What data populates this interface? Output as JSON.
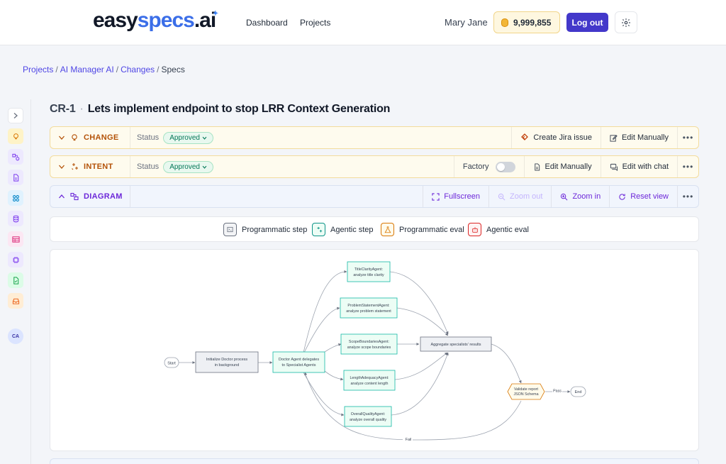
{
  "header": {
    "logo": {
      "part1": "easy",
      "part2": "specs",
      "part3": ".ai"
    },
    "nav": [
      {
        "label": "Dashboard"
      },
      {
        "label": "Projects"
      }
    ],
    "user_name": "Mary Jane",
    "credits": "9,999,855",
    "logout_label": "Log out"
  },
  "breadcrumb": {
    "items": [
      {
        "label": "Projects"
      },
      {
        "label": "AI Manager AI"
      },
      {
        "label": "Changes"
      }
    ],
    "current": "Specs",
    "separator": "/"
  },
  "page": {
    "code": "CR-1",
    "title": "Lets implement endpoint to stop LRR Context Generation"
  },
  "sidebar": {
    "icons": [
      "chevron-right-icon",
      "lightbulb-icon",
      "shapes-icon",
      "document-icon",
      "grid-icon",
      "database-icon",
      "table-icon",
      "chip-icon",
      "check-doc-icon",
      "tray-icon"
    ],
    "avatar": "CA"
  },
  "sections": {
    "change": {
      "label": "CHANGE",
      "status_label": "Status",
      "status": "Approved",
      "actions": {
        "jira": "Create Jira issue",
        "edit": "Edit Manually"
      }
    },
    "intent": {
      "label": "INTENT",
      "status_label": "Status",
      "status": "Approved",
      "factory_label": "Factory",
      "factory_on": false,
      "actions": {
        "edit": "Edit Manually",
        "chat": "Edit with chat"
      }
    },
    "diagram": {
      "label": "DIAGRAM",
      "actions": {
        "fullscreen": "Fullscreen",
        "zoom_out": "Zoom out",
        "zoom_in": "Zoom in",
        "reset": "Reset view"
      }
    }
  },
  "legend": [
    {
      "label": "Programmatic step",
      "color": "#6b7280"
    },
    {
      "label": "Agentic step",
      "color": "#0d9488"
    },
    {
      "label": "Programmatic eval",
      "color": "#d97706"
    },
    {
      "label": "Agentic eval",
      "color": "#dc2626"
    }
  ],
  "flow": {
    "start": "Start",
    "init": [
      "Initialize Doctor process",
      "in background"
    ],
    "doctor": [
      "Doctor Agent delegates",
      "to Specialist Agents"
    ],
    "agents": [
      [
        "TitleClarityAgent:",
        "analyze title clarity"
      ],
      [
        "ProblemStatementAgent:",
        "analyze problem statement"
      ],
      [
        "ScopeBoundariesAgent:",
        "analyze scope boundaries"
      ],
      [
        "LengthAdequacyAgent:",
        "analyze content length"
      ],
      [
        "OverallQualityAgent:",
        "analyze overall quality"
      ]
    ],
    "aggregate": "Aggregate specialists' results",
    "validate": [
      "Validate report",
      "JSON Schema"
    ],
    "pass": "Pass",
    "fail": "Fail",
    "end": "End"
  }
}
